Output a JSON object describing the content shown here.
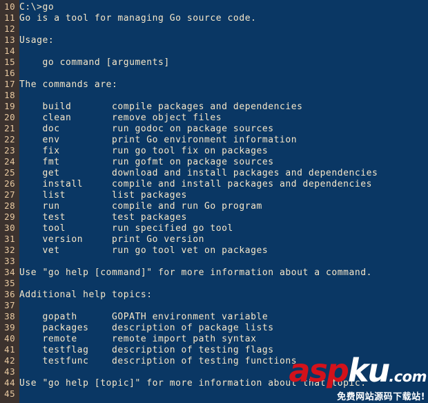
{
  "console": {
    "background_color": "#0a3764",
    "text_color": "#f6e7c9",
    "gutter_background_color": "#3c322e",
    "gutter_text_color": "#e9caa2",
    "first_line_number": 10,
    "lines": [
      {
        "no": "10",
        "text": "C:\\>go"
      },
      {
        "no": "11",
        "text": "Go is a tool for managing Go source code."
      },
      {
        "no": "12",
        "text": ""
      },
      {
        "no": "13",
        "text": "Usage:"
      },
      {
        "no": "14",
        "text": ""
      },
      {
        "no": "15",
        "text": "    go command [arguments]"
      },
      {
        "no": "16",
        "text": ""
      },
      {
        "no": "17",
        "text": "The commands are:"
      },
      {
        "no": "18",
        "text": ""
      },
      {
        "no": "19",
        "text": "    build       compile packages and dependencies"
      },
      {
        "no": "20",
        "text": "    clean       remove object files"
      },
      {
        "no": "21",
        "text": "    doc         run godoc on package sources"
      },
      {
        "no": "22",
        "text": "    env         print Go environment information"
      },
      {
        "no": "23",
        "text": "    fix         run go tool fix on packages"
      },
      {
        "no": "24",
        "text": "    fmt         run gofmt on package sources"
      },
      {
        "no": "25",
        "text": "    get         download and install packages and dependencies"
      },
      {
        "no": "26",
        "text": "    install     compile and install packages and dependencies"
      },
      {
        "no": "27",
        "text": "    list        list packages"
      },
      {
        "no": "28",
        "text": "    run         compile and run Go program"
      },
      {
        "no": "29",
        "text": "    test        test packages"
      },
      {
        "no": "30",
        "text": "    tool        run specified go tool"
      },
      {
        "no": "31",
        "text": "    version     print Go version"
      },
      {
        "no": "32",
        "text": "    vet         run go tool vet on packages"
      },
      {
        "no": "33",
        "text": ""
      },
      {
        "no": "34",
        "text": "Use \"go help [command]\" for more information about a command."
      },
      {
        "no": "35",
        "text": ""
      },
      {
        "no": "36",
        "text": "Additional help topics:"
      },
      {
        "no": "37",
        "text": ""
      },
      {
        "no": "38",
        "text": "    gopath      GOPATH environment variable"
      },
      {
        "no": "39",
        "text": "    packages    description of package lists"
      },
      {
        "no": "40",
        "text": "    remote      remote import path syntax"
      },
      {
        "no": "41",
        "text": "    testflag    description of testing flags"
      },
      {
        "no": "42",
        "text": "    testfunc    description of testing functions"
      },
      {
        "no": "43",
        "text": ""
      },
      {
        "no": "44",
        "text": "Use \"go help [topic]\" for more information about that topic."
      },
      {
        "no": "45",
        "text": ""
      }
    ]
  },
  "watermark": {
    "word_first": "asp",
    "word_second": "ku",
    "tld": ".com",
    "subtitle": "免费网站源码下载站!",
    "first_color": "#d4121b",
    "second_color": "#ffffff"
  }
}
